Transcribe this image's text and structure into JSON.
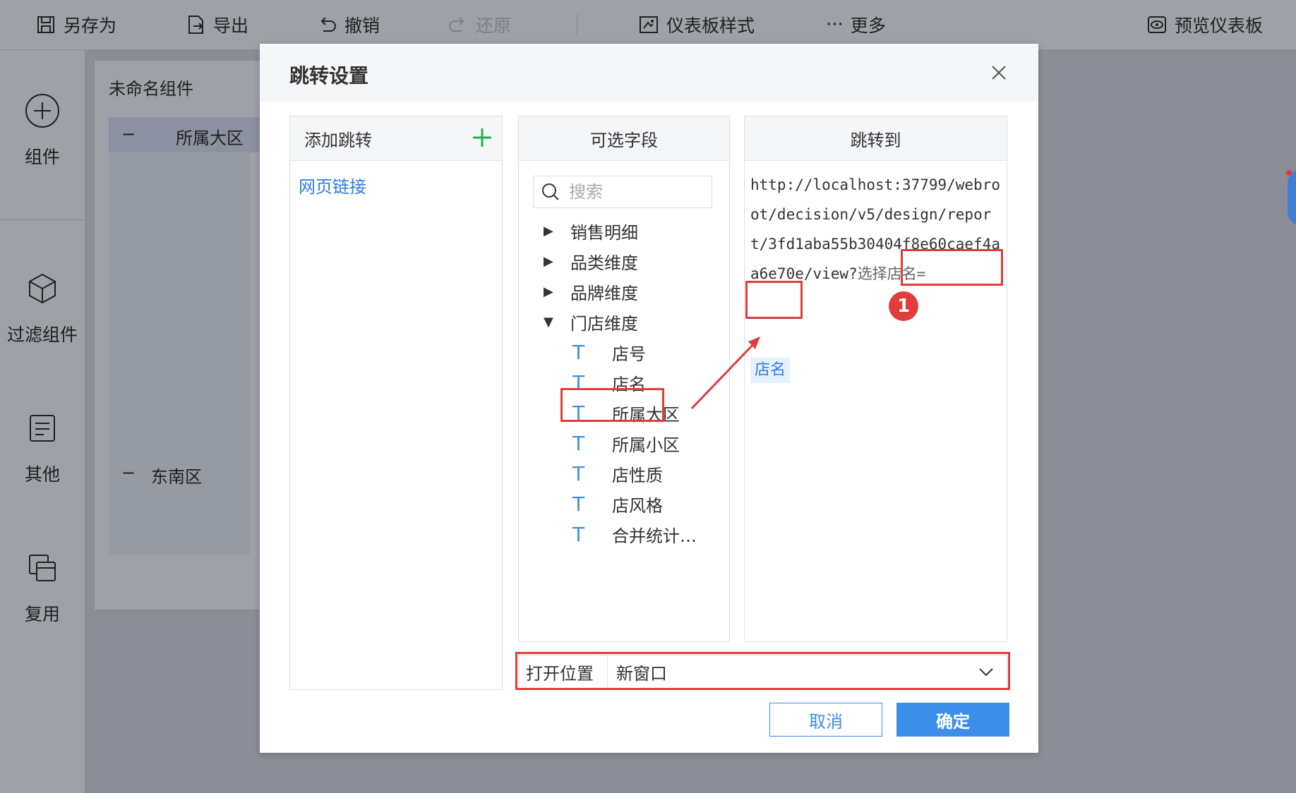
{
  "toolbar": {
    "save_as": "另存为",
    "export": "导出",
    "undo": "撤销",
    "redo": "还原",
    "dashboard_style": "仪表板样式",
    "more": "更多",
    "preview": "预览仪表板"
  },
  "sidebar": {
    "items": [
      {
        "label": "组件",
        "icon": "plus-circle-icon"
      },
      {
        "label": "过滤组件",
        "icon": "cube-icon"
      },
      {
        "label": "其他",
        "icon": "document-icon"
      },
      {
        "label": "复用",
        "icon": "copy-icon"
      }
    ]
  },
  "canvas": {
    "component_title": "未命名组件",
    "row1_minus": "−",
    "row1_label": "所属大区",
    "row2_minus": "−",
    "row2_label": "东南区"
  },
  "dialog": {
    "title": "跳转设置",
    "close_icon": "close-icon",
    "add_jump": {
      "header": "添加跳转",
      "items": [
        "网页链接"
      ]
    },
    "fields": {
      "header": "可选字段",
      "search_placeholder": "搜索",
      "tree": [
        {
          "label": "销售明细",
          "type": "group",
          "expanded": false
        },
        {
          "label": "品类维度",
          "type": "group",
          "expanded": false
        },
        {
          "label": "品牌维度",
          "type": "group",
          "expanded": false
        },
        {
          "label": "门店维度",
          "type": "group",
          "expanded": true
        },
        {
          "label": "店号",
          "type": "text-field"
        },
        {
          "label": "店名",
          "type": "text-field"
        },
        {
          "label": "所属大区",
          "type": "text-field"
        },
        {
          "label": "所属小区",
          "type": "text-field"
        },
        {
          "label": "店性质",
          "type": "text-field"
        },
        {
          "label": "店风格",
          "type": "text-field"
        },
        {
          "label": "合并统计…",
          "type": "text-field"
        }
      ]
    },
    "jump_to": {
      "header": "跳转到",
      "url": "http://localhost:37799/webroot/decision/v5/design/report/3fd1aba55b30404f8e60caef4aa6e70e/view?",
      "param": "选择店名=",
      "field_tag": "店名"
    },
    "open_position": {
      "label": "打开位置",
      "value": "新窗口"
    },
    "cancel_label": "取消",
    "ok_label": "确定"
  },
  "annotation": {
    "badge": "1"
  },
  "colors": {
    "accent": "#3d8ee8",
    "highlight": "#e23c3c",
    "link": "#2f7ddf",
    "add_green": "#22b24c"
  }
}
